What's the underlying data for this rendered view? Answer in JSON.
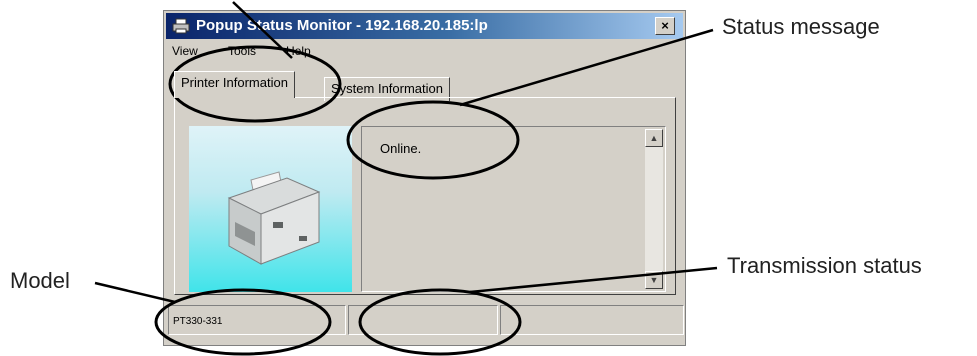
{
  "window": {
    "title": "Popup Status Monitor - 192.168.20.185:lp",
    "close_symbol": "×"
  },
  "menu": [
    {
      "label": "View"
    },
    {
      "label": "Tools"
    },
    {
      "label": "Help"
    }
  ],
  "tabs": [
    {
      "label": "Printer Information",
      "active": true
    },
    {
      "label": "System Information",
      "active": false
    }
  ],
  "status": {
    "message": "Online."
  },
  "statusbar": {
    "model": "PT330-331",
    "transmission": ""
  },
  "callouts": {
    "status_message": "Status message",
    "model": "Model",
    "transmission_status": "Transmission status"
  },
  "icons": {
    "app": "printer-icon",
    "close": "close-icon",
    "scroll_up": "arrow-up-icon"
  },
  "colors": {
    "title_start": "#0a246a",
    "title_end": "#a6caf0",
    "window_face": "#d4d0c8",
    "image_bg": "#40e4ea"
  }
}
